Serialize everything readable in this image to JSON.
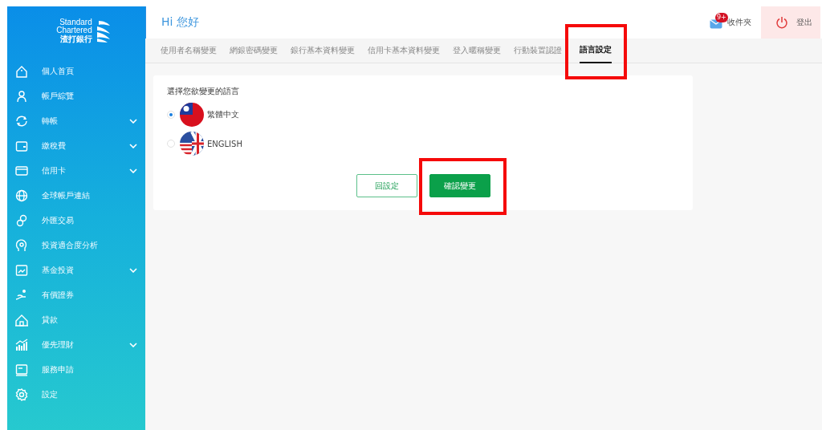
{
  "brand": {
    "line_1": "Standard",
    "line_2": "Chartered",
    "line_3": "渣打銀行"
  },
  "sidebar": {
    "items": [
      {
        "label": "個人首頁",
        "expandable": false
      },
      {
        "label": "帳戶綜覽",
        "expandable": false
      },
      {
        "label": "轉帳",
        "expandable": true
      },
      {
        "label": "繳稅費",
        "expandable": true
      },
      {
        "label": "信用卡",
        "expandable": true
      },
      {
        "label": "全球帳戶連結",
        "expandable": false
      },
      {
        "label": "外匯交易",
        "expandable": false
      },
      {
        "label": "投資適合度分析",
        "expandable": false
      },
      {
        "label": "基金投資",
        "expandable": true
      },
      {
        "label": "有價證券",
        "expandable": false
      },
      {
        "label": "貸款",
        "expandable": false
      },
      {
        "label": "優先理財",
        "expandable": true
      },
      {
        "label": "服務申請",
        "expandable": false
      },
      {
        "label": "設定",
        "expandable": false
      }
    ]
  },
  "header": {
    "greeting": "Hi 您好",
    "inbox": {
      "badge": "9+",
      "label": "收件夾"
    },
    "logout": {
      "label": "登出"
    }
  },
  "tabs": [
    {
      "label": "使用者名稱變更",
      "selected": false,
      "highlighted": false
    },
    {
      "label": "網銀密碼變更",
      "selected": false,
      "highlighted": false
    },
    {
      "label": "銀行基本資料變更",
      "selected": false,
      "highlighted": false
    },
    {
      "label": "信用卡基本資料變更",
      "selected": false,
      "highlighted": false
    },
    {
      "label": "登入暱稱變更",
      "selected": false,
      "highlighted": false
    },
    {
      "label": "行動裝置認證",
      "selected": false,
      "highlighted": false
    },
    {
      "label": "語言設定",
      "selected": true,
      "highlighted": true
    }
  ],
  "language_form": {
    "heading": "選擇您欲變更的語言",
    "options": [
      {
        "label": "繁體中文",
        "selected": true
      },
      {
        "label": "ENGLISH",
        "selected": false
      }
    ],
    "buttons": [
      {
        "label": "回設定",
        "kind": "secondary",
        "highlighted": false
      },
      {
        "label": "確認變更",
        "kind": "primary",
        "highlighted": true
      }
    ]
  }
}
